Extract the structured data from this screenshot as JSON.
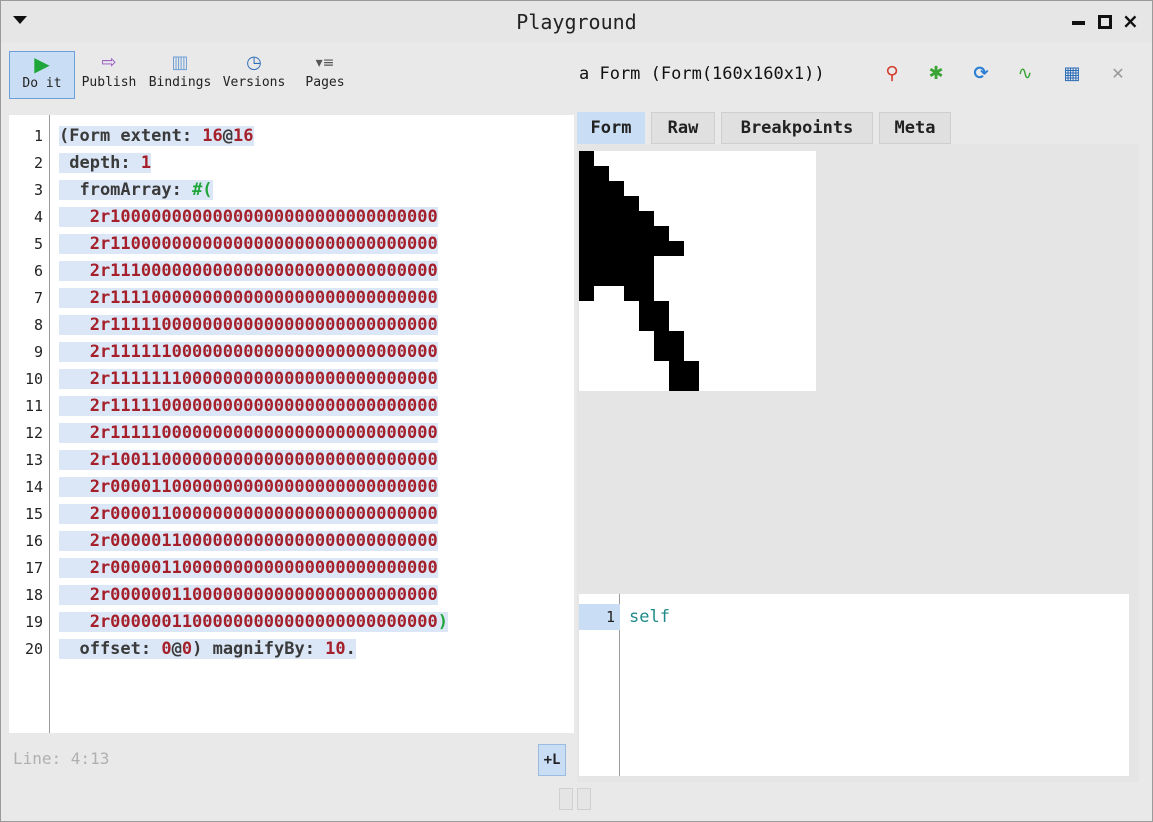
{
  "window": {
    "title": "Playground"
  },
  "toolbar": {
    "doit": {
      "icon": "play-icon",
      "label": "Do it"
    },
    "publish": {
      "icon": "publish-icon",
      "label": "Publish"
    },
    "bindings": {
      "icon": "bindings-icon",
      "label": "Bindings"
    },
    "versions": {
      "icon": "versions-icon",
      "label": "Versions"
    },
    "pages": {
      "icon": "pages-icon",
      "label": "Pages"
    }
  },
  "editor": {
    "lines": [
      {
        "no": "1",
        "parts": [
          [
            "sym",
            "(Form extent: "
          ],
          [
            "num",
            "16"
          ],
          [
            "sym",
            "@"
          ],
          [
            "num",
            "16"
          ]
        ]
      },
      {
        "no": "2",
        "parts": [
          [
            "sym",
            " depth: "
          ],
          [
            "num",
            "1"
          ]
        ]
      },
      {
        "no": "3",
        "parts": [
          [
            "sym",
            "  fromArray: "
          ],
          [
            "paren",
            "#("
          ]
        ]
      },
      {
        "no": "4",
        "parts": [
          [
            "num",
            "   2r10000000000000000000000000000000"
          ]
        ]
      },
      {
        "no": "5",
        "parts": [
          [
            "num",
            "   2r11000000000000000000000000000000"
          ]
        ]
      },
      {
        "no": "6",
        "parts": [
          [
            "num",
            "   2r11100000000000000000000000000000"
          ]
        ]
      },
      {
        "no": "7",
        "parts": [
          [
            "num",
            "   2r11110000000000000000000000000000"
          ]
        ]
      },
      {
        "no": "8",
        "parts": [
          [
            "num",
            "   2r11111000000000000000000000000000"
          ]
        ]
      },
      {
        "no": "9",
        "parts": [
          [
            "num",
            "   2r11111100000000000000000000000000"
          ]
        ]
      },
      {
        "no": "10",
        "parts": [
          [
            "num",
            "   2r11111110000000000000000000000000"
          ]
        ]
      },
      {
        "no": "11",
        "parts": [
          [
            "num",
            "   2r11111000000000000000000000000000"
          ]
        ]
      },
      {
        "no": "12",
        "parts": [
          [
            "num",
            "   2r11111000000000000000000000000000"
          ]
        ]
      },
      {
        "no": "13",
        "parts": [
          [
            "num",
            "   2r10011000000000000000000000000000"
          ]
        ]
      },
      {
        "no": "14",
        "parts": [
          [
            "num",
            "   2r00001100000000000000000000000000"
          ]
        ]
      },
      {
        "no": "15",
        "parts": [
          [
            "num",
            "   2r00001100000000000000000000000000"
          ]
        ]
      },
      {
        "no": "16",
        "parts": [
          [
            "num",
            "   2r00000110000000000000000000000000"
          ]
        ]
      },
      {
        "no": "17",
        "parts": [
          [
            "num",
            "   2r00000110000000000000000000000000"
          ]
        ]
      },
      {
        "no": "18",
        "parts": [
          [
            "num",
            "   2r00000011000000000000000000000000"
          ]
        ]
      },
      {
        "no": "19",
        "parts": [
          [
            "num",
            "   2r00000011000000000000000000000000"
          ],
          [
            "paren",
            ")"
          ]
        ]
      },
      {
        "no": "20",
        "parts": [
          [
            "sym",
            "  offset: "
          ],
          [
            "num",
            "0"
          ],
          [
            "sym",
            "@"
          ],
          [
            "num",
            "0"
          ],
          [
            "sym",
            ") magnifyBy: "
          ],
          [
            "num",
            "10"
          ],
          [
            "sym",
            "."
          ]
        ]
      }
    ]
  },
  "status": {
    "line": "Line: 4:13",
    "plus_l": "+L"
  },
  "inspector": {
    "title": "a Form (Form(160x160x1))",
    "tabs": [
      "Form",
      "Raw",
      "Breakpoints",
      "Meta"
    ],
    "icons": [
      "explore-icon",
      "bug-icon",
      "refresh-icon",
      "path-icon",
      "grid-icon",
      "close-icon"
    ],
    "form_bits": [
      "10000000",
      "11000000",
      "11100000",
      "11110000",
      "11111000",
      "11111100",
      "11111110",
      "11111000",
      "11111000",
      "10011000",
      "00001100",
      "00001100",
      "00000110",
      "00000110",
      "00000011",
      "00000011"
    ]
  },
  "evaluator": {
    "line_no": "1",
    "code": "self"
  }
}
